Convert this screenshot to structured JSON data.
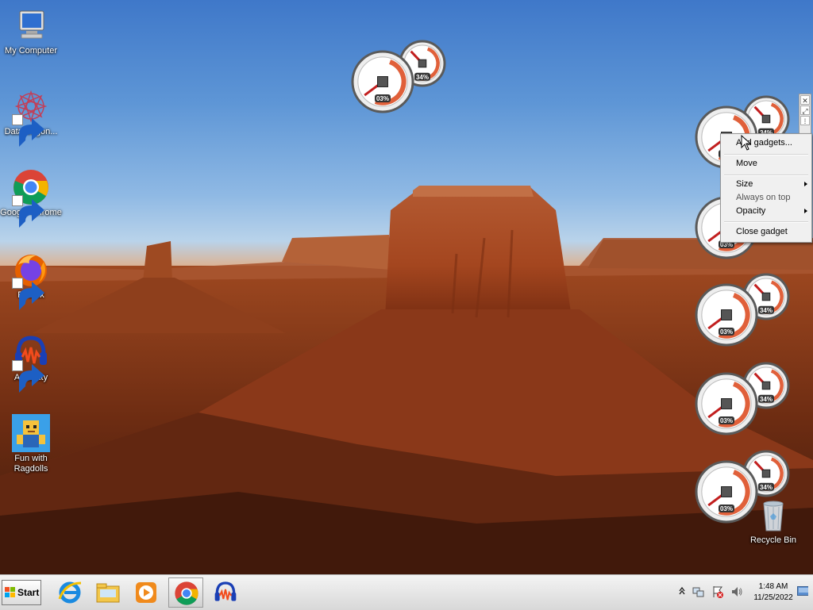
{
  "desktop": {
    "icons": [
      {
        "label": "My Computer"
      },
      {
        "label": "DataWagon..."
      },
      {
        "label": "Google Chrome"
      },
      {
        "label": "Firefox"
      },
      {
        "label": "Audacity"
      },
      {
        "label": "Fun with Ragdolls"
      },
      {
        "label": "Recycle Bin"
      }
    ]
  },
  "gadgets": {
    "cpu_label": "03%",
    "ram_label": "34%",
    "cpu_value": 0.03,
    "ram_value": 0.34
  },
  "context_menu": {
    "items": [
      {
        "label": "Add gadgets..."
      },
      {
        "label": "Move"
      },
      {
        "label": "Size"
      },
      {
        "label": "Always on top"
      },
      {
        "label": "Opacity"
      },
      {
        "label": "Close gadget"
      }
    ]
  },
  "taskbar": {
    "start_label": "Start",
    "pinned": [
      {
        "name": "Internet Explorer"
      },
      {
        "name": "Windows Explorer"
      },
      {
        "name": "Windows Media Player"
      },
      {
        "name": "Google Chrome"
      },
      {
        "name": "Audacity"
      }
    ],
    "clock_time": "1:48 AM",
    "clock_date": "11/25/2022"
  },
  "icons_semantic": [
    "computer-icon",
    "datawagon-icon",
    "chrome-icon",
    "firefox-icon",
    "audacity-icon",
    "ragdolls-icon",
    "recycle-bin-icon",
    "ie-icon",
    "explorer-icon",
    "media-player-icon"
  ]
}
